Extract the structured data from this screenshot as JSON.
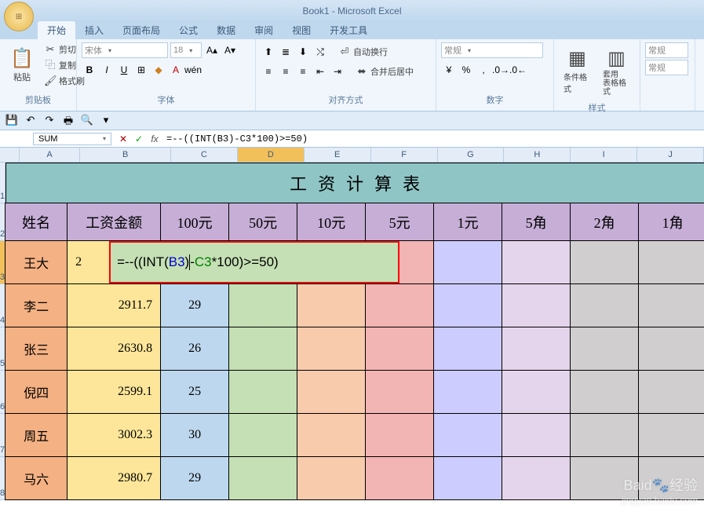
{
  "title": "Book1 - Microsoft Excel",
  "tabs": [
    "开始",
    "插入",
    "页面布局",
    "公式",
    "数据",
    "审阅",
    "视图",
    "开发工具"
  ],
  "active_tab": 0,
  "ribbon": {
    "clipboard": {
      "cut": "剪切",
      "copy": "复制",
      "brush": "格式刷",
      "paste": "粘贴",
      "label": "剪贴板"
    },
    "font": {
      "name": "宋体",
      "size": "18",
      "label": "字体"
    },
    "align": {
      "wrap": "自动换行",
      "merge": "合并后居中",
      "label": "对齐方式"
    },
    "number": {
      "format": "常规",
      "label": "数字"
    },
    "styles": {
      "cond": "条件格式",
      "table": "套用\n表格格式",
      "label": "样式"
    },
    "side": {
      "normal": "常规",
      "normal2": "常规"
    }
  },
  "namebox": "SUM",
  "formula": "=--((INT(B3)-C3*100)>=50)",
  "columns": [
    "A",
    "B",
    "C",
    "D",
    "E",
    "F",
    "G",
    "H",
    "I",
    "J"
  ],
  "table": {
    "title": "工资计算表",
    "headers": [
      "姓名",
      "工资金额",
      "100元",
      "50元",
      "10元",
      "5元",
      "1元",
      "5角",
      "2角",
      "1角"
    ],
    "rows": [
      {
        "name": "王大",
        "amount": "2",
        "c": "",
        "edit": true
      },
      {
        "name": "李二",
        "amount": "2911.7",
        "c": "29"
      },
      {
        "name": "张三",
        "amount": "2630.8",
        "c": "26"
      },
      {
        "name": "倪四",
        "amount": "2599.1",
        "c": "25"
      },
      {
        "name": "周五",
        "amount": "3002.3",
        "c": "30"
      },
      {
        "name": "马六",
        "amount": "2980.7",
        "c": "29"
      }
    ]
  },
  "edit_overlay": {
    "prefix": "=--((INT(",
    "b3": "B3",
    "mid": ")",
    "dash": "-",
    "c3": "C3",
    "suffix": "*100)>=50)"
  },
  "watermark": {
    "brand": "Baid",
    "ex": "经验",
    "url": "jingyan.baidu.com"
  },
  "chart_data": {
    "type": "table",
    "title": "工资计算表",
    "columns": [
      "姓名",
      "工资金额",
      "100元",
      "50元",
      "10元",
      "5元",
      "1元",
      "5角",
      "2角",
      "1角"
    ],
    "rows": [
      [
        "王大",
        null,
        null,
        null,
        null,
        null,
        null,
        null,
        null,
        null
      ],
      [
        "李二",
        2911.7,
        29,
        null,
        null,
        null,
        null,
        null,
        null,
        null
      ],
      [
        "张三",
        2630.8,
        26,
        null,
        null,
        null,
        null,
        null,
        null,
        null
      ],
      [
        "倪四",
        2599.1,
        25,
        null,
        null,
        null,
        null,
        null,
        null,
        null
      ],
      [
        "周五",
        3002.3,
        30,
        null,
        null,
        null,
        null,
        null,
        null,
        null
      ],
      [
        "马六",
        2980.7,
        29,
        null,
        null,
        null,
        null,
        null,
        null,
        null
      ]
    ],
    "active_cell": "D3",
    "active_formula": "=--((INT(B3)-C3*100)>=50)"
  }
}
